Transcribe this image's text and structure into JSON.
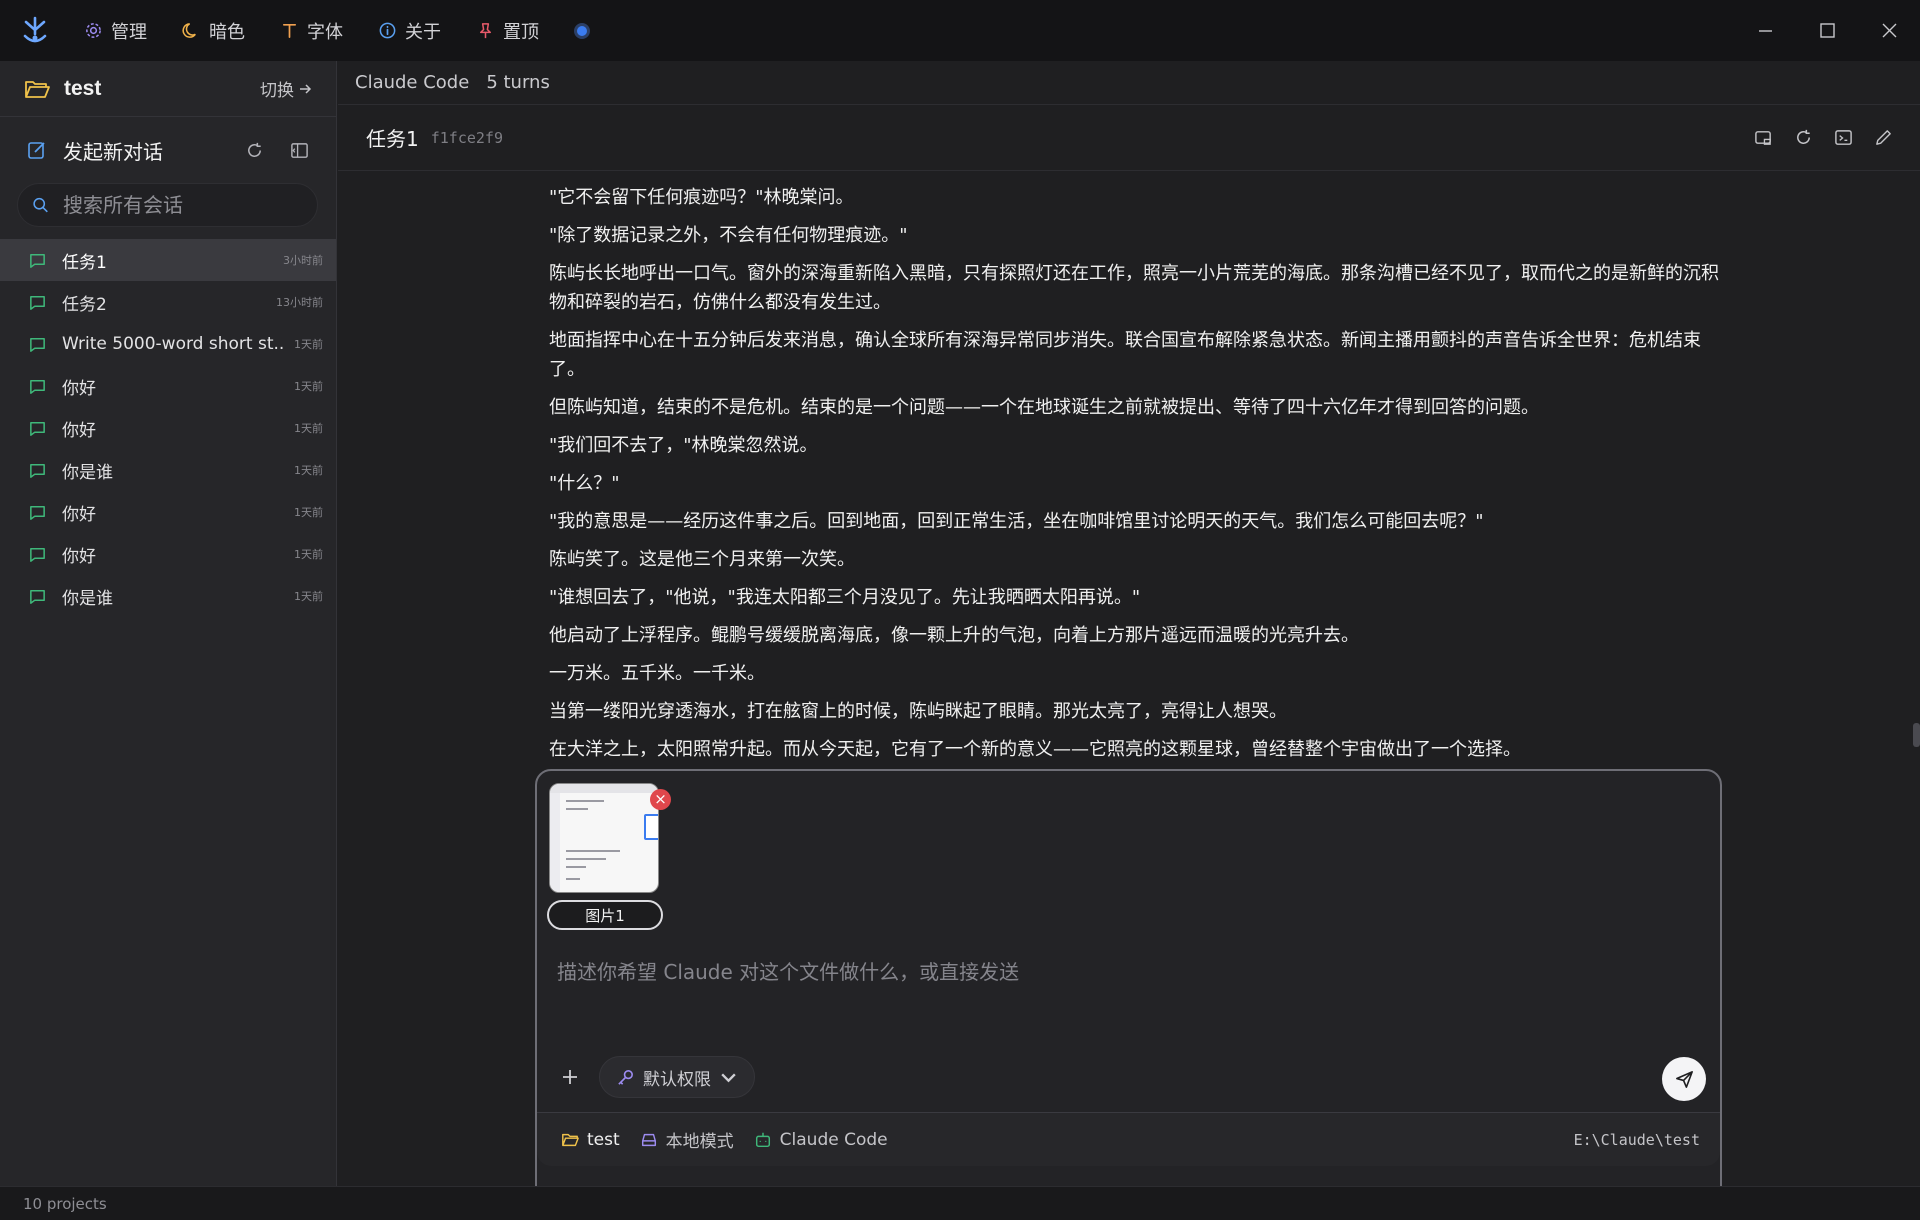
{
  "topbar": {
    "menu": [
      {
        "label": "管理",
        "icon": "gear-icon"
      },
      {
        "label": "暗色",
        "icon": "moon-icon"
      },
      {
        "label": "字体",
        "icon": "font-icon"
      },
      {
        "label": "关于",
        "icon": "info-icon"
      },
      {
        "label": "置顶",
        "icon": "pin-icon"
      }
    ],
    "status_color": "#3b7cf0"
  },
  "sidebar": {
    "project_name": "test",
    "switch_label": "切换",
    "new_chat_label": "发起新对话",
    "search_placeholder": "搜索所有会话",
    "conversations": [
      {
        "title": "任务1",
        "time": "3小时前",
        "active": true
      },
      {
        "title": "任务2",
        "time": "13小时前"
      },
      {
        "title": "Write 5000-word short st...",
        "time": "1天前"
      },
      {
        "title": "你好",
        "time": "1天前"
      },
      {
        "title": "你好",
        "time": "1天前"
      },
      {
        "title": "你是谁",
        "time": "1天前"
      },
      {
        "title": "你好",
        "time": "1天前"
      },
      {
        "title": "你好",
        "time": "1天前"
      },
      {
        "title": "你是谁",
        "time": "1天前"
      }
    ]
  },
  "footer": {
    "projects_count": "10 projects"
  },
  "main": {
    "breadcrumb": {
      "agent": "Claude Code",
      "turns": "5 turns"
    },
    "task": {
      "title": "任务1",
      "hash": "f1fce2f9"
    },
    "transcript": [
      "\"它不会留下任何痕迹吗？\"林晚棠问。",
      "\"除了数据记录之外，不会有任何物理痕迹。\"",
      "陈屿长长地呼出一口气。窗外的深海重新陷入黑暗，只有探照灯还在工作，照亮一小片荒芜的海底。那条沟槽已经不见了，取而代之的是新鲜的沉积物和碎裂的岩石，仿佛什么都没有发生过。",
      "地面指挥中心在十五分钟后发来消息，确认全球所有深海异常同步消失。联合国宣布解除紧急状态。新闻主播用颤抖的声音告诉全世界：危机结束了。",
      "但陈屿知道，结束的不是危机。结束的是一个问题——一个在地球诞生之前就被提出、等待了四十六亿年才得到回答的问题。",
      "\"我们回不去了，\"林晚棠忽然说。",
      "\"什么？\"",
      "\"我的意思是——经历这件事之后。回到地面，回到正常生活，坐在咖啡馆里讨论明天的天气。我们怎么可能回去呢？\"",
      "陈屿笑了。这是他三个月来第一次笑。",
      "\"谁想回去了，\"他说，\"我连太阳都三个月没见了。先让我晒晒太阳再说。\"",
      "他启动了上浮程序。鲲鹏号缓缓脱离海底，像一颗上升的气泡，向着上方那片遥远而温暖的光亮升去。",
      "一万米。五千米。一千米。",
      "当第一缕阳光穿透海水，打在舷窗上的时候，陈屿眯起了眼睛。那光太亮了，亮得让人想哭。",
      "在大洋之上，太阳照常升起。而从今天起，它有了一个新的意义——它照亮的这颗星球，曾经替整个宇宙做出了一个选择。"
    ]
  },
  "composer": {
    "attachment_name": "图片1",
    "placeholder": "描述你希望 Claude 对这个文件做什么，或直接发送",
    "permission_label": "默认权限",
    "footer": {
      "project": "test",
      "mode": "本地模式",
      "agent": "Claude Code",
      "path": "E:\\Claude\\test"
    }
  }
}
